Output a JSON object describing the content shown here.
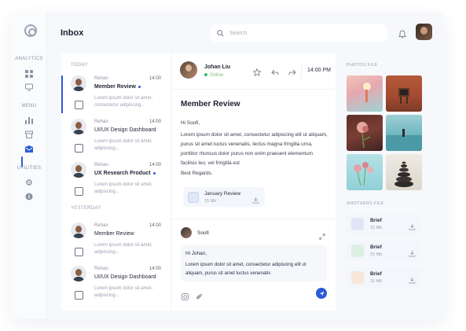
{
  "sidebar": {
    "analytics_label": "ANALYTICS",
    "menu_label": "MENU",
    "utilities_label": "UTILITIES"
  },
  "header": {
    "title": "Inbox",
    "search_placeholder": "Search"
  },
  "list": {
    "today_label": "TODAY",
    "yesterday_label": "YESTERDAY",
    "items": [
      {
        "sender": "Rehan",
        "time": "14:00",
        "subject": "Member Review",
        "preview": "Lorem ipsum dolor sit amet, consectetur adipiscing..."
      },
      {
        "sender": "Rehan",
        "time": "14:00",
        "subject": "UI/UX Design Dashboard",
        "preview": "Lorem ipsum dolor sit amet, adipiscing..."
      },
      {
        "sender": "Rehan",
        "time": "14:00",
        "subject": "UX Research Product",
        "preview": "Lorem ipsum dolor sit amet, adipiscing..."
      },
      {
        "sender": "Rehan",
        "time": "14:00",
        "subject": "Member Review",
        "preview": "Lorem ipsum dolor sit amet, adipiscing..."
      },
      {
        "sender": "Rehan",
        "time": "14:00",
        "subject": "UI/UX Design Dashboard",
        "preview": "Lorem ipsum dolor sit amet, adipiscing..."
      }
    ]
  },
  "reading": {
    "contact_name": "Johan Liu",
    "contact_status": "Online",
    "time": "14:00 PM",
    "subject": "Member Review",
    "greeting": "Hi Soofi,",
    "body": "Lorem ipsum dolor sit amet, consectetur adipiscing elit ut aliquam, purus sit amet luctus venenatis, lectus magna fringilla urna, porttitor rhoncus dolor purus non enim praesent elementum facilisis leo, vel fringilla est",
    "signoff": "Best Regards.",
    "attachment": {
      "name": "January Review",
      "size": "15 Mb"
    },
    "reply": {
      "name": "Soofi",
      "greeting": "Hi Johan,",
      "body": "Lorem ipsum dolor sit amet, consectetur adipiscing elit ut aliquam, purus sit amet luctus venenatis"
    }
  },
  "files": {
    "photos_label": "PHOTOS FILE",
    "others_label": "ANOTHERS FILE",
    "docs": [
      {
        "name": "Brief",
        "size": "15 Mb",
        "color": "#dfe7f7"
      },
      {
        "name": "Brief",
        "size": "15 Mb",
        "color": "#dcefe3"
      },
      {
        "name": "Brief",
        "size": "15 Mb",
        "color": "#f8e6d8"
      }
    ]
  },
  "colors": {
    "accent": "#2c5bd7",
    "online": "#35b86a"
  }
}
